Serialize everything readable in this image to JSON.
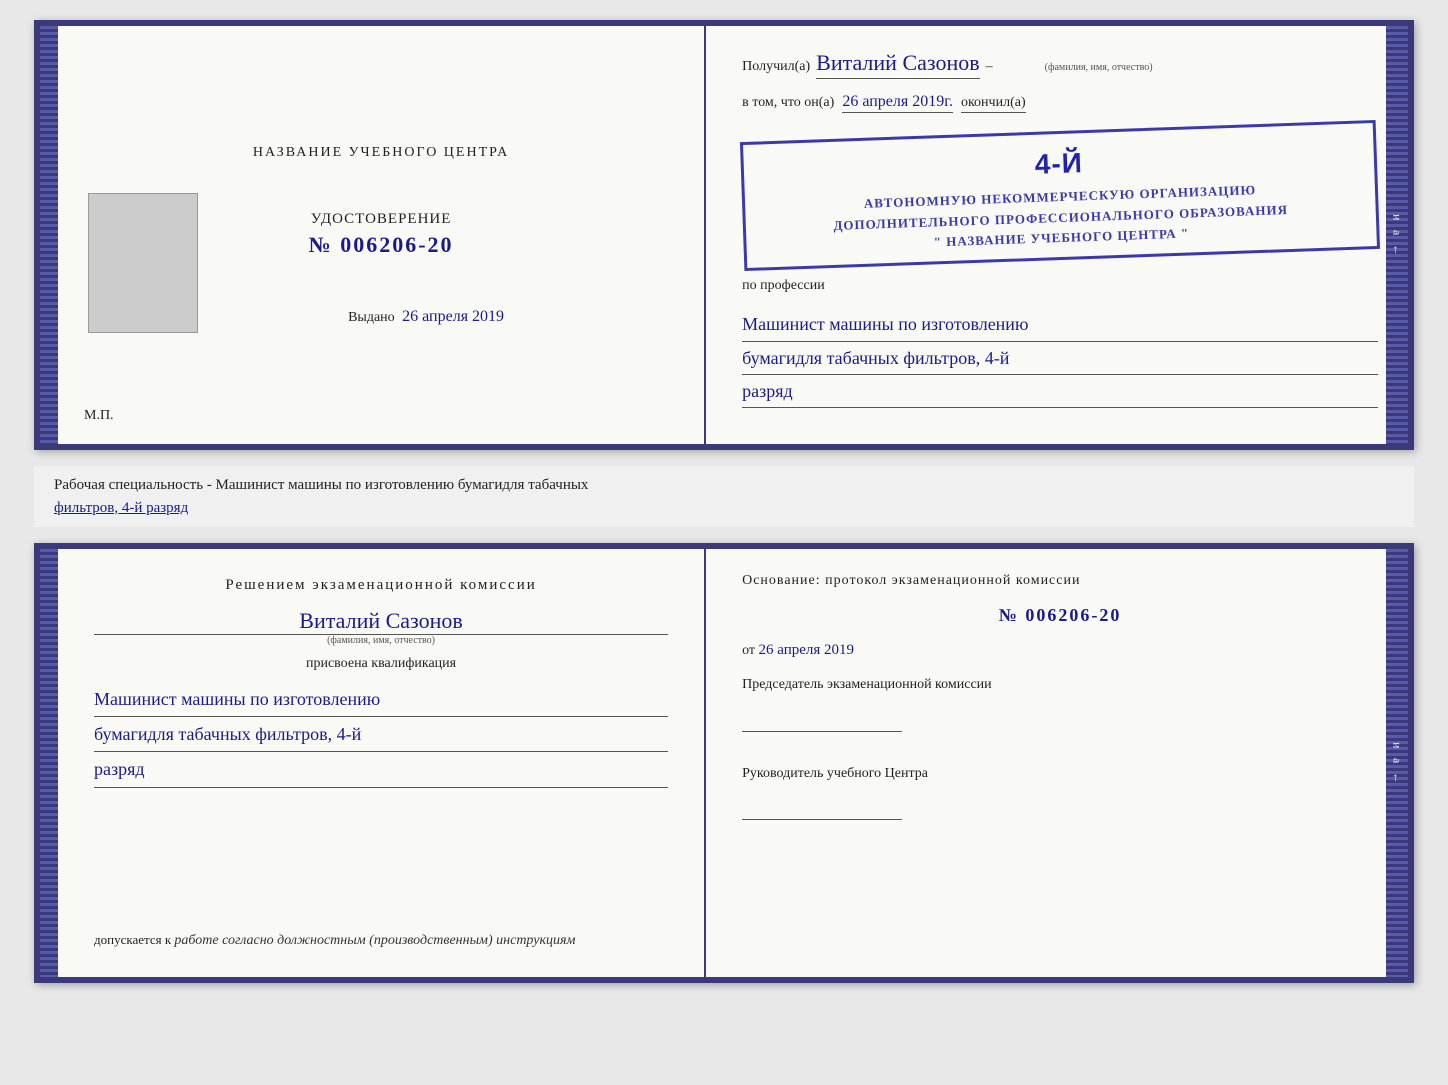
{
  "top_cert": {
    "left": {
      "header": "НАЗВАНИЕ УЧЕБНОГО ЦЕНТРА",
      "udostoverenie_label": "УДОСТОВЕРЕНИЕ",
      "number": "№ 006206-20",
      "vydano_label": "Выдано",
      "vydano_date": "26 апреля 2019",
      "mp_label": "М.П."
    },
    "right": {
      "poluchil_prefix": "Получил(а)",
      "name_handwritten": "Виталий Сазонов",
      "fio_hint": "(фамилия, имя, отчество)",
      "dash": "–",
      "vtom_prefix": "в том, что он(а)",
      "date_handwritten": "26 апреля 2019г.",
      "okonchill": "окончил(а)",
      "stamp_number": "4-й",
      "stamp_line1": "АВТОНОМНУЮ НЕКОММЕРЧЕСКУЮ ОРГАНИЗАЦИЮ",
      "stamp_line2": "ДОПОЛНИТЕЛЬНОГО ПРОФЕССИОНАЛЬНОГО ОБРАЗОВАНИЯ",
      "stamp_line3": "\" НАЗВАНИЕ УЧЕБНОГО ЦЕНТРА \"",
      "i_mark": "и",
      "a_mark": "а",
      "arrow_mark": "←",
      "po_professii": "по профессии",
      "profession_line1": "Машинист машины по изготовлению",
      "profession_line2": "бумагидля табачных фильтров, 4-й",
      "profession_line3": "разряд"
    }
  },
  "caption": {
    "text": "Рабочая специальность - Машинист машины по изготовлению бумагидля табачных",
    "underline_text": "фильтров, 4-й разряд"
  },
  "bottom_cert": {
    "left": {
      "resheniem_label": "Решением  экзаменационной  комиссии",
      "name_handwritten": "Виталий Сазонов",
      "fio_hint": "(фамилия, имя, отчество)",
      "prisvoena_label": "присвоена квалификация",
      "qual_line1": "Машинист машины по изготовлению",
      "qual_line2": "бумагидля табачных фильтров, 4-й",
      "qual_line3": "разряд",
      "dopuskaetsya_prefix": "допускается к",
      "dopuskaetsya_text": "работе согласно должностным (производственным) инструкциям"
    },
    "right": {
      "osnovanie_label": "Основание: протокол экзаменационной  комиссии",
      "number": "№  006206-20",
      "ot_prefix": "от",
      "ot_date": "26 апреля 2019",
      "chairman_label": "Председатель экзаменационной комиссии",
      "rukovoditel_label": "Руководитель учебного Центра",
      "i_mark": "и",
      "a_mark": "а",
      "arrow_mark": "←"
    }
  }
}
